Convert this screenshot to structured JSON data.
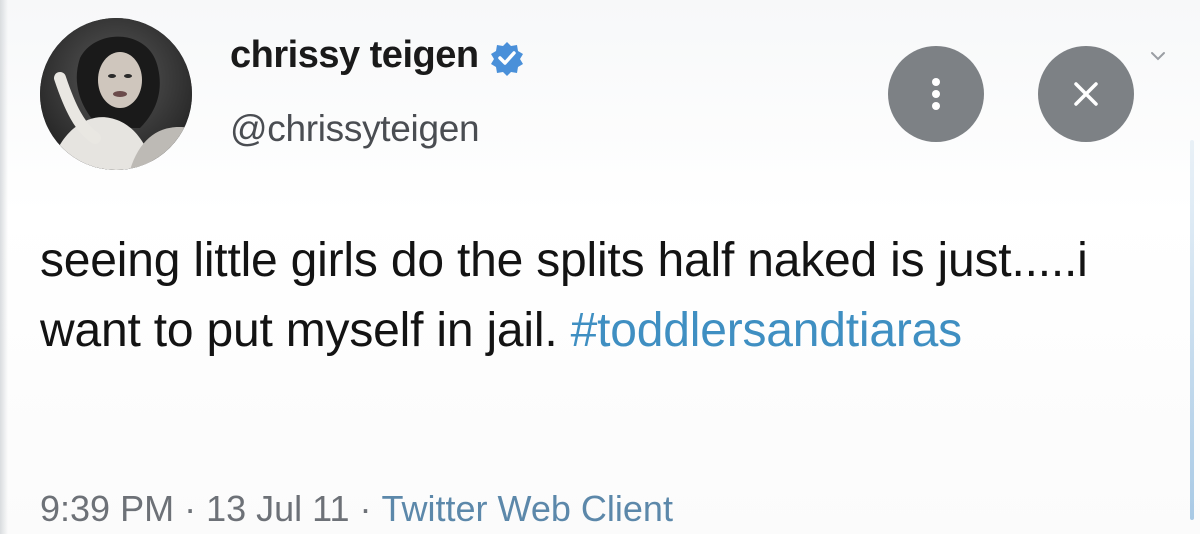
{
  "user": {
    "name": "chrissy teigen",
    "handle": "@chrissyteigen",
    "verified": true,
    "verified_color": "#4a90d9"
  },
  "controls": {
    "more_icon": "more-vertical-icon",
    "close_icon": "close-icon"
  },
  "tweet": {
    "text": "seeing little girls do the splits half naked is just.....i want to put myself in jail.",
    "hashtag": "#toddlersandtiaras",
    "hashtag_color": "#3f8fc2"
  },
  "meta": {
    "time": "9:39 PM",
    "separator": "·",
    "date": "13 Jul 11",
    "source": "Twitter Web Client"
  }
}
